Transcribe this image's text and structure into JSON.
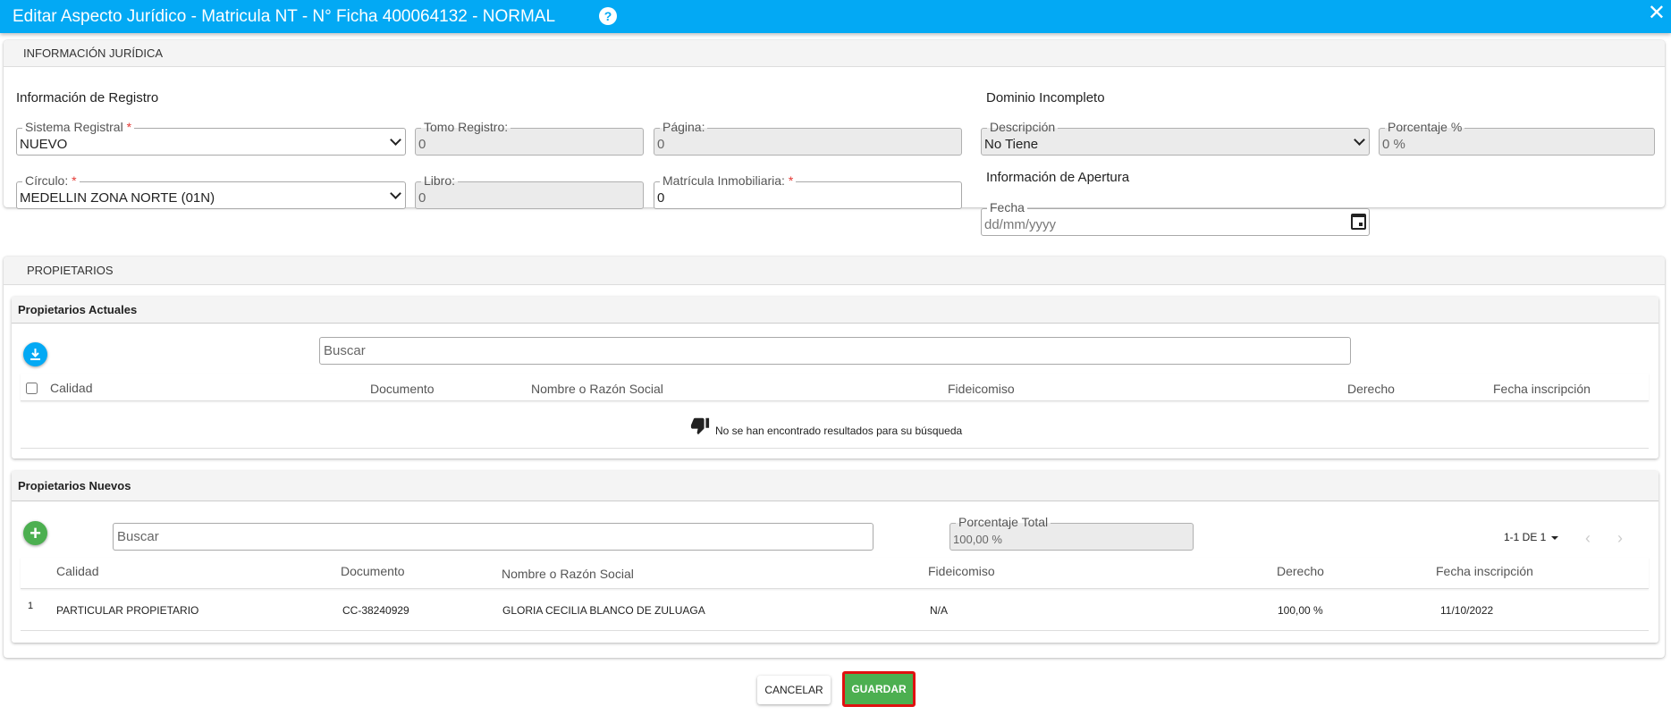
{
  "header": {
    "title": "Editar Aspecto Jurídico - Matricula NT - N° Ficha 400064132 - NORMAL",
    "help_icon": "?",
    "close_icon": "✕"
  },
  "juridica": {
    "section_title": "INFORMACIÓN JURÍDICA",
    "registro_title": "Información de Registro",
    "sistema_registral": {
      "label": "Sistema Registral",
      "required": "*",
      "value": "NUEVO"
    },
    "tomo_registro": {
      "label": "Tomo Registro:",
      "value": "0"
    },
    "pagina": {
      "label": "Página:",
      "value": "0"
    },
    "circulo": {
      "label": "Círculo:",
      "required": "*",
      "value": "MEDELLIN ZONA NORTE (01N)"
    },
    "libro": {
      "label": "Libro:",
      "value": "0"
    },
    "matricula_inmobiliaria": {
      "label": "Matrícula Inmobiliaria:",
      "required": "*",
      "value": "0"
    },
    "dominio_title": "Dominio Incompleto",
    "descripcion": {
      "label": "Descripción",
      "value": "No Tiene"
    },
    "porcentaje": {
      "label": "Porcentaje %",
      "value": "0 %"
    },
    "apertura_title": "Información de Apertura",
    "fecha": {
      "label": "Fecha",
      "placeholder": "dd/mm/yyyy"
    }
  },
  "propietarios": {
    "section_title": "PROPIETARIOS",
    "actuales": {
      "title": "Propietarios Actuales",
      "search_placeholder": "Buscar",
      "columns": [
        "Calidad",
        "Documento",
        "Nombre o Razón Social",
        "Fideicomiso",
        "Derecho",
        "Fecha inscripción"
      ],
      "empty_message": "No se han encontrado resultados para su búsqueda"
    },
    "nuevos": {
      "title": "Propietarios Nuevos",
      "search_placeholder": "Buscar",
      "porcentaje_total": {
        "label": "Porcentaje Total",
        "value": "100,00 %"
      },
      "pagination": "1-1 DE 1",
      "columns": [
        "Calidad",
        "Documento",
        "Nombre o Razón Social",
        "Fideicomiso",
        "Derecho",
        "Fecha inscripción"
      ],
      "rows": [
        {
          "index": "1",
          "calidad": "PARTICULAR PROPIETARIO",
          "documento": "CC-38240929",
          "nombre": "GLORIA CECILIA BLANCO DE ZULUAGA",
          "fideicomiso": "N/A",
          "derecho": "100,00 %",
          "fecha": "11/10/2022"
        }
      ]
    }
  },
  "footer": {
    "cancel_label": "CANCELAR",
    "save_label": "GUARDAR"
  },
  "colors": {
    "header": "#03a9f4",
    "save": "#4caf50",
    "highlight": "#e01010",
    "required": "#e53935"
  }
}
